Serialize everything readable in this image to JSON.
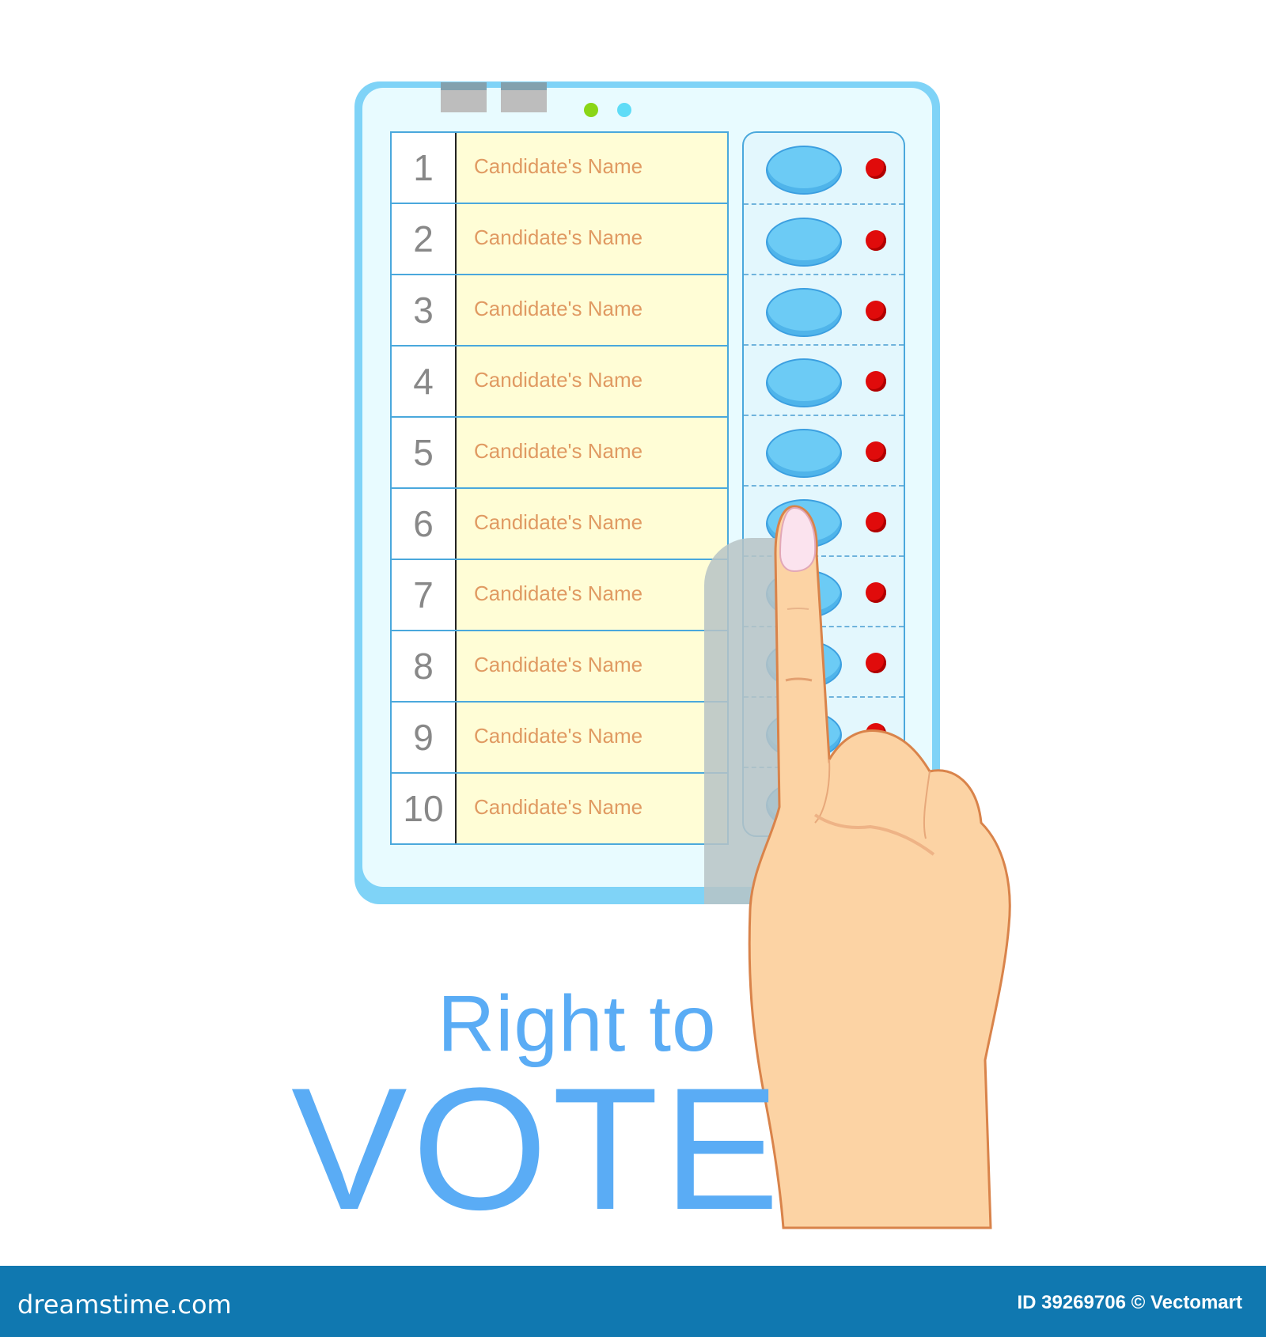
{
  "machine": {
    "candidates": [
      {
        "number": "1",
        "name": "Candidate's Name"
      },
      {
        "number": "2",
        "name": "Candidate's Name"
      },
      {
        "number": "3",
        "name": "Candidate's Name"
      },
      {
        "number": "4",
        "name": "Candidate's Name"
      },
      {
        "number": "5",
        "name": "Candidate's Name"
      },
      {
        "number": "6",
        "name": "Candidate's Name"
      },
      {
        "number": "7",
        "name": "Candidate's Name"
      },
      {
        "number": "8",
        "name": "Candidate's Name"
      },
      {
        "number": "9",
        "name": "Candidate's Name"
      },
      {
        "number": "10",
        "name": "Candidate's Name"
      }
    ],
    "pressed_button": 6,
    "colors": {
      "body": "#7fd3f7",
      "name_cell": "#fffdd6",
      "button": "#6ccbf5",
      "lamp": "#e00b0b",
      "led_green": "#8ad616",
      "led_cyan": "#5fdcf7"
    }
  },
  "headline": {
    "line1": "Right to",
    "line2": "VOTE",
    "color": "#5aacf5"
  },
  "footer": {
    "brand": "dreamstime.com",
    "credit": "ID 39269706 © Vectomart",
    "color": "#1078b0"
  }
}
